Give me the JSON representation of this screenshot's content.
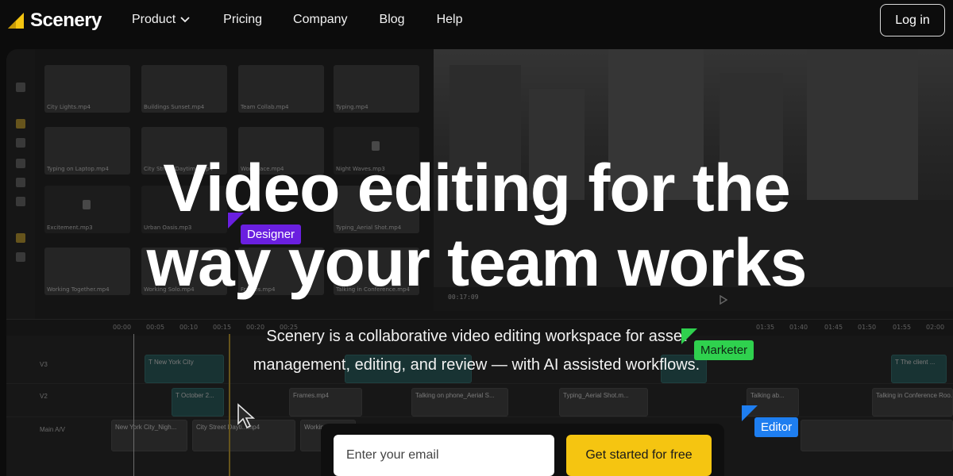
{
  "brand": {
    "name": "Scenery",
    "accent": "#f5c511"
  },
  "nav": {
    "links": [
      {
        "label": "Product",
        "has_dropdown": true
      },
      {
        "label": "Pricing"
      },
      {
        "label": "Company"
      },
      {
        "label": "Blog"
      },
      {
        "label": "Help"
      }
    ],
    "login_label": "Log in"
  },
  "hero": {
    "headline_line1": "Video editing for the",
    "headline_line2": "way your team works",
    "subline_line1": "Scenery is a collaborative video editing workspace for asset",
    "subline_line2": "management, editing, and review — with AI assisted workflows."
  },
  "cursor_tags": {
    "designer": {
      "label": "Designer",
      "color": "#6a1fe0"
    },
    "marketer": {
      "label": "Marketer",
      "color": "#2fd14e"
    },
    "editor": {
      "label": "Editor",
      "color": "#1e7ef0"
    }
  },
  "cta": {
    "email_placeholder": "Enter your email",
    "button_label": "Get started for free"
  },
  "editor_bg": {
    "media": [
      "City Lights.mp4",
      "Buildings Sunset.mp4",
      "Team Collab.mp4",
      "Typing.mp4",
      "Typing on Laptop.mp4",
      "City Street Daytime.mp4",
      "Workplace.mp4",
      "Night Waves.mp3",
      "Excitement.mp3",
      "Urban Oasis.mp3",
      "Typing_Aerial Shot.mp4",
      "Working Together.mp4",
      "Working Solo.mp4",
      "Frames.mp4",
      "Talking in Conference.mp4"
    ],
    "preview_time": "00:17:09",
    "ruler": [
      "00:00",
      "00:05",
      "00:10",
      "00:15",
      "00:20",
      "00:25",
      "01:35",
      "01:40",
      "01:45",
      "01:50",
      "01:55",
      "02:00"
    ],
    "tracks": [
      "V3",
      "V2",
      "Main A/V"
    ],
    "clips": {
      "v3_a": "T New York City",
      "v3_b": "T The client ...",
      "v2_a": "T October 2...",
      "v2_b": "Frames.mp4",
      "v2_c": "Talking on phone_Aerial S...",
      "v2_d": "Typing_Aerial Shot.m...",
      "v2_e": "Talking ab...",
      "v2_f": "Talking in Conference Roo...",
      "main_a": "New York City_Nigh...",
      "main_b": "City Street Dayti...mp4",
      "main_c": "Workin..."
    }
  }
}
